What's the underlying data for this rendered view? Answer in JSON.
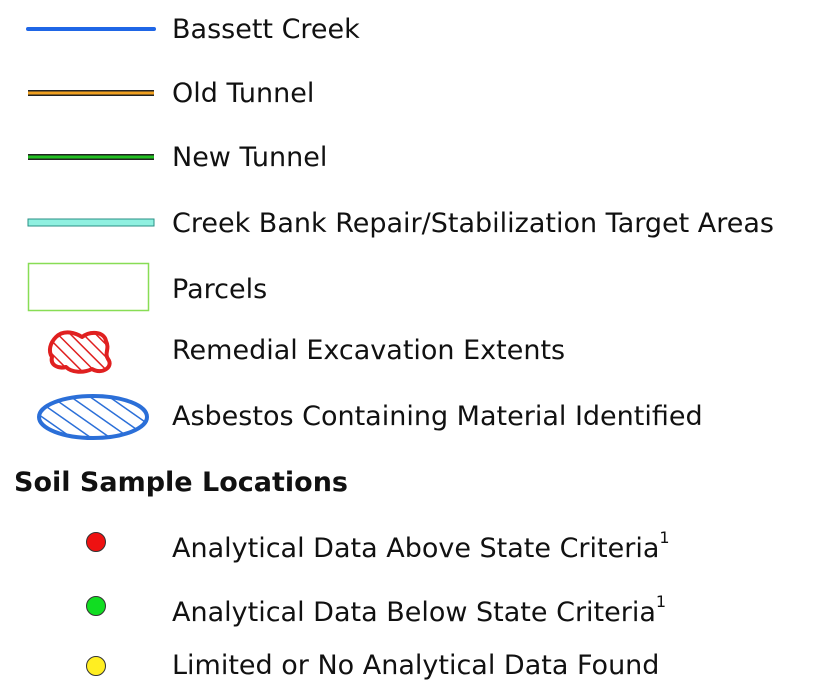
{
  "legend": {
    "items": [
      {
        "label": "Bassett Creek",
        "icon": "blue-line-icon",
        "color": "#1f66e6"
      },
      {
        "label": "Old Tunnel",
        "icon": "orange-line-icon",
        "color": "#f0a020",
        "outline": "#222222"
      },
      {
        "label": "New Tunnel",
        "icon": "green-line-icon",
        "color": "#22c022",
        "outline": "#222222"
      },
      {
        "label": "Creek Bank Repair/Stabilization Target Areas",
        "icon": "cyan-band-icon",
        "color": "#8ff0e0",
        "outline": "#2a8f85"
      },
      {
        "label": "Parcels",
        "icon": "parcel-rectangle-icon",
        "color": "#88dd55"
      },
      {
        "label": "Remedial Excavation Extents",
        "icon": "red-hatched-polygon-icon",
        "color": "#e02020"
      },
      {
        "label": "Asbestos Containing Material Identified",
        "icon": "blue-hatched-ellipse-icon",
        "color": "#2b6fd8"
      }
    ],
    "section_title": "Soil Sample Locations",
    "samples": [
      {
        "label": "Analytical Data Above State Criteria",
        "sup": "1",
        "icon": "red-dot-icon",
        "color": "#ee1111"
      },
      {
        "label": "Analytical Data Below State Criteria",
        "sup": "1",
        "icon": "green-dot-icon",
        "color": "#11dd22"
      },
      {
        "label": "Limited or No Analytical Data Found",
        "sup": "",
        "icon": "yellow-dot-icon",
        "color": "#ffee22"
      }
    ]
  }
}
